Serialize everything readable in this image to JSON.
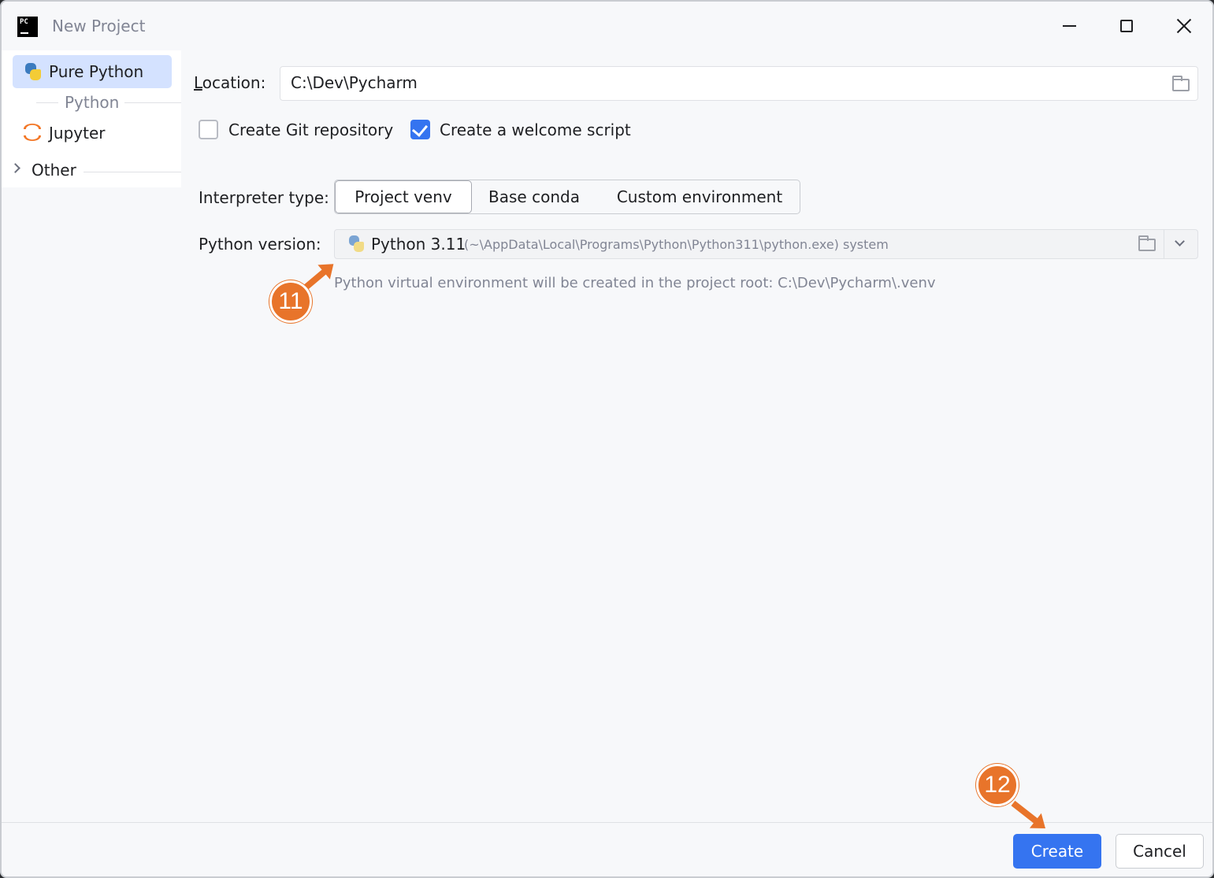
{
  "window": {
    "title": "New Project",
    "app_logo_text": "PC"
  },
  "sidebar": {
    "items": [
      {
        "label": "Pure Python",
        "icon": "python-icon",
        "selected": true
      },
      {
        "label": "Jupyter",
        "icon": "jupyter-icon",
        "selected": false
      }
    ],
    "group_label": "Python",
    "other_label": "Other"
  },
  "form": {
    "location_label": "ocation:",
    "location_mnemonic": "L",
    "location_value": "C:\\Dev\\Pycharm",
    "git_checkbox": {
      "label": "Create Git repository",
      "checked": false
    },
    "welcome_checkbox": {
      "label": "Create a welcome script",
      "checked": true
    },
    "interpreter_label": "Interpreter type:",
    "interpreter_options": [
      "Project venv",
      "Base conda",
      "Custom environment"
    ],
    "interpreter_selected": "Project venv",
    "python_version_label": "Python version:",
    "python_version_main": "Python 3.11",
    "python_version_path": "(~\\AppData\\Local\\Programs\\Python\\Python311\\python.exe) system",
    "hint": "Python virtual environment will be created in the project root: C:\\Dev\\Pycharm\\.venv"
  },
  "buttons": {
    "create": "Create",
    "cancel": "Cancel"
  },
  "callouts": [
    "11",
    "12"
  ],
  "colors": {
    "accent": "#3574f0",
    "callout": "#e8742a",
    "selection": "#d4e2ff"
  }
}
